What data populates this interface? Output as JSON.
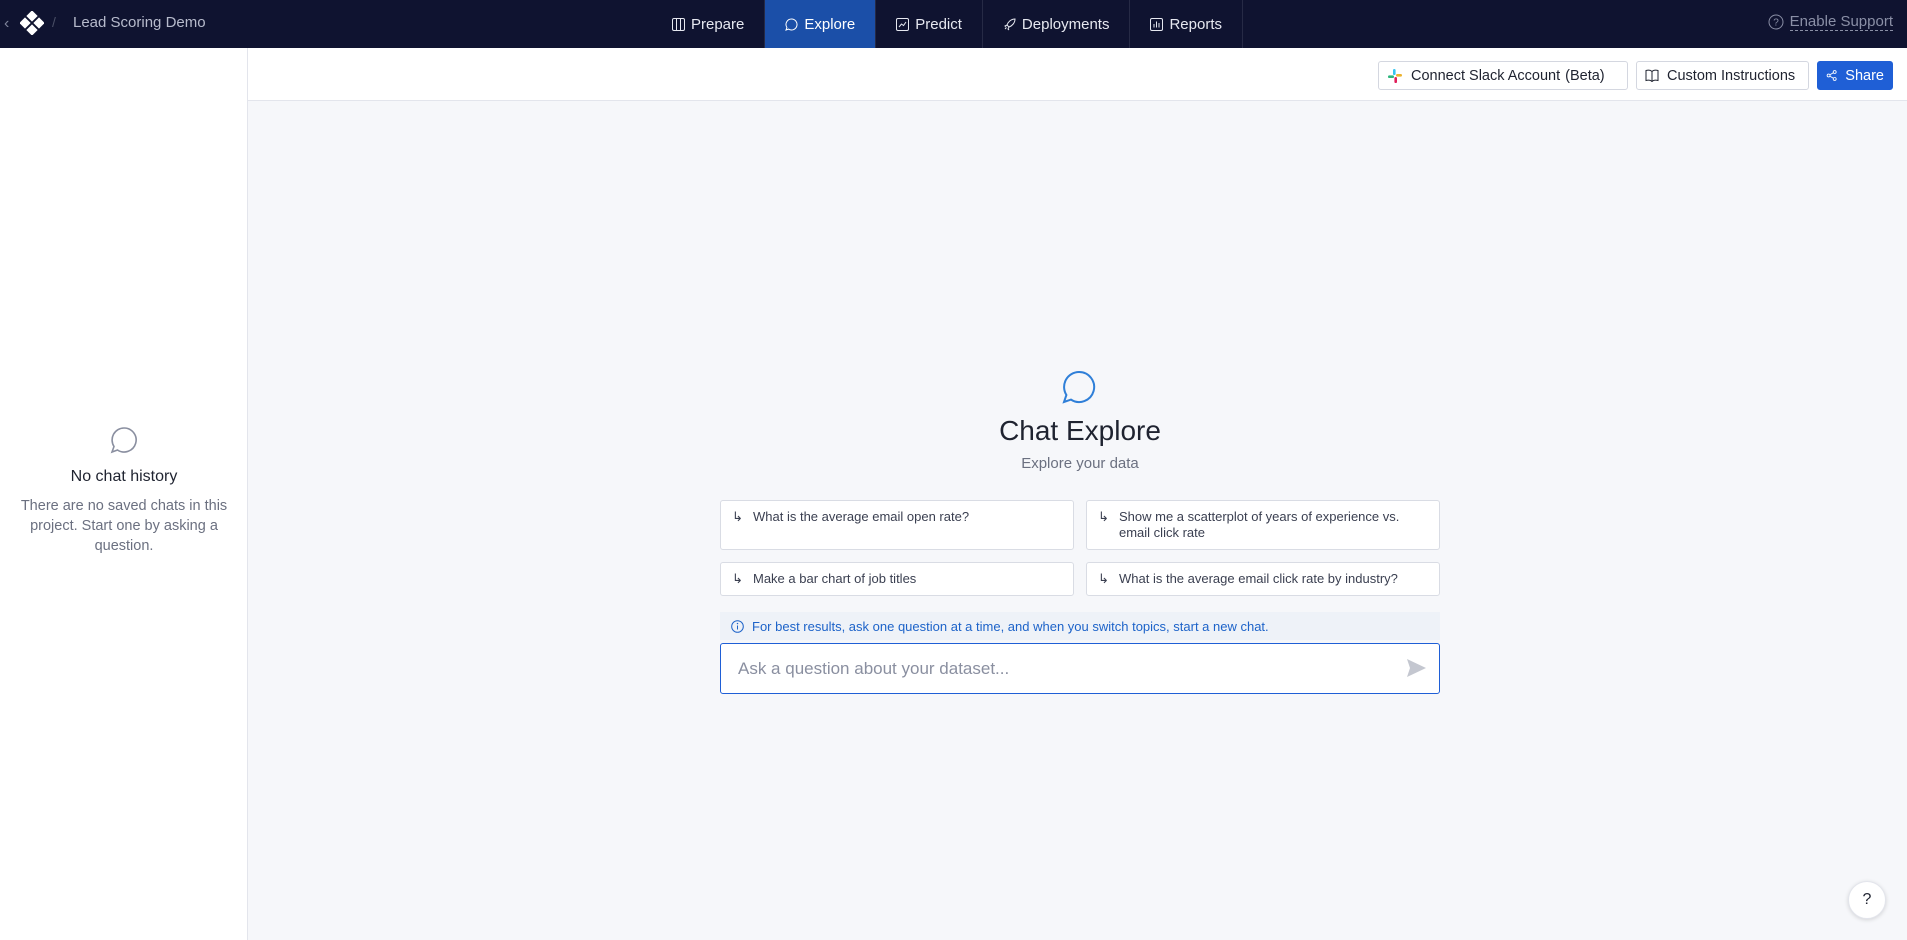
{
  "header": {
    "project_name": "Lead Scoring Demo",
    "tabs": [
      {
        "label": "Prepare",
        "icon": "table-icon"
      },
      {
        "label": "Explore",
        "icon": "chat-icon"
      },
      {
        "label": "Predict",
        "icon": "chart-icon"
      },
      {
        "label": "Deployments",
        "icon": "rocket-icon"
      },
      {
        "label": "Reports",
        "icon": "report-icon"
      }
    ],
    "active_tab": "Explore",
    "support_label": "Enable Support"
  },
  "sidebar": {
    "empty_title": "No chat history",
    "empty_text": "There are no saved chats in this project. Start one by asking a question."
  },
  "toolbar": {
    "slack_label": "Connect Slack Account",
    "slack_badge": "(Beta)",
    "custom_instructions_label": "Custom Instructions",
    "share_label": "Share"
  },
  "main": {
    "title": "Chat Explore",
    "subtitle": "Explore your data",
    "suggestions": [
      "What is the average email open rate?",
      "Show me a scatterplot of years of experience vs. email click rate",
      "Make a bar chart of job titles",
      "What is the average email click rate by industry?"
    ],
    "tip": "For best results, ask one question at a time, and when you switch topics, start a new chat.",
    "input_placeholder": "Ask a question about your dataset...",
    "input_value": ""
  },
  "help_label": "?",
  "colors": {
    "nav_bg": "#0f1330",
    "active_tab": "#1b4fa8",
    "accent": "#1f5fd6"
  }
}
